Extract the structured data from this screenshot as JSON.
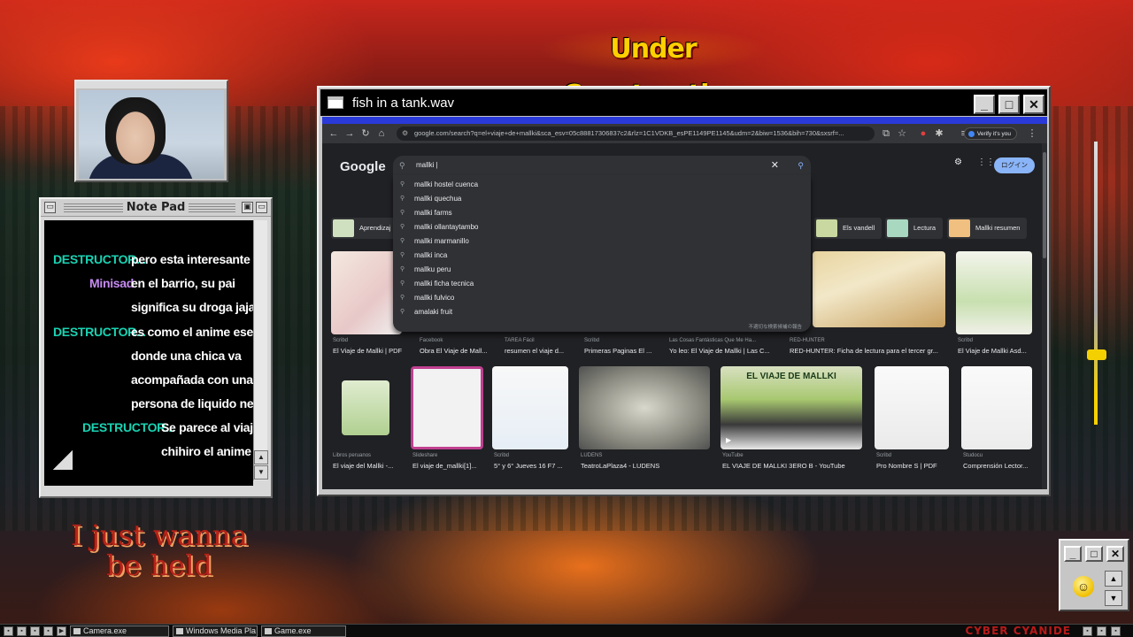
{
  "banner": {
    "text": "Under Construction"
  },
  "slogan": {
    "line1": "I just wanna",
    "line2": "be held"
  },
  "notepad": {
    "title": "Note Pad",
    "messages": [
      {
        "user": "DESTRUCTOR...",
        "text": "pero esta interesante"
      },
      {
        "user": "Minisad",
        "text": "en el barrio, su pai"
      },
      {
        "user": "",
        "text": "significa su droga jajajaja"
      },
      {
        "user": "DESTRUCTOR...",
        "text": "es como el anime ese"
      },
      {
        "user": "",
        "text": "donde una chica va"
      },
      {
        "user": "",
        "text": "acompañada con una"
      },
      {
        "user": "",
        "text": "persona de liquido negro"
      },
      {
        "user": "DESTRUCTOR...",
        "text": "Se parece al viaje de"
      },
      {
        "user": "",
        "text": "chihiro el anime de F"
      }
    ],
    "colors": {
      "destructor": "#19d3b3",
      "minisad": "#c58af0"
    }
  },
  "app_window": {
    "title": "fish in a tank.wav",
    "controls": {
      "minimize": "_",
      "maximize": "□",
      "close": "✕"
    }
  },
  "browser": {
    "url": "google.com/search?q=el+viaje+de+mallki&sca_esv=05c88817306837c2&rlz=1C1VDKB_esPE1149PE1145&udm=2&biw=1536&bih=730&sxsrf=...",
    "verify_chip": "Verify it's you",
    "google_logo": "Google",
    "search_value": "mallki |",
    "suggestions": [
      "mallki hostel cuenca",
      "mallki quechua",
      "mallki farms",
      "mallki ollantaytambo",
      "mallki marmanillo",
      "mallki inca",
      "mallku peru",
      "mallki ficha tecnica",
      "mallki fulvico",
      "amalaki fruit"
    ],
    "suggestion_report": "不適切な検索候補の報告",
    "login_label": "ログイン",
    "chips": [
      {
        "label": "Aprendizaj"
      },
      {
        "label": "Els vandell"
      },
      {
        "label": "Lectura"
      },
      {
        "label": "Mallki resumen"
      }
    ],
    "results_row1": [
      {
        "source": "Scribd",
        "title": "El Viaje de Mallki | PDF"
      },
      {
        "source": "Facebook",
        "title": "Obra El Viaje de Mall..."
      },
      {
        "source": "TAREA Fácil",
        "title": "resumen el viaje d..."
      },
      {
        "source": "Scribd",
        "title": "Primeras Paginas El ..."
      },
      {
        "source": "Las Cosas Fantásticas Que Me Ha...",
        "title": "Yo leo: El Viaje de Mallki | Las C..."
      },
      {
        "source": "RED-HUNTER",
        "title": "RED-HUNTER: Ficha de lectura para el tercer gr..."
      },
      {
        "source": "Scribd",
        "title": "El Viaje de Mallki Asd..."
      }
    ],
    "results_row2": [
      {
        "source": "Libros peruanos",
        "title": "El viaje del Mallki -..."
      },
      {
        "source": "Slideshare",
        "title": "El viaje de_mallki[1]..."
      },
      {
        "source": "Scribd",
        "title": "5° y 6° Jueves 16 F7 ..."
      },
      {
        "source": "LUDENS",
        "title": "TeatroLaPlaza4 - LUDENS"
      },
      {
        "source": "YouTube",
        "title": "EL VIAJE DE MALLKI 3ERO B - YouTube"
      },
      {
        "source": "Scribd",
        "title": "Pro Nombre S | PDF"
      },
      {
        "source": "Studocu",
        "title": "Comprensión Lector..."
      }
    ],
    "video_caption": "EL VIAJE DE MALLKI"
  },
  "taskbar": {
    "items": [
      "Camera.exe",
      "Windows Media Pla",
      "Game.exe"
    ],
    "brand": "CYBER CYANIDE"
  }
}
